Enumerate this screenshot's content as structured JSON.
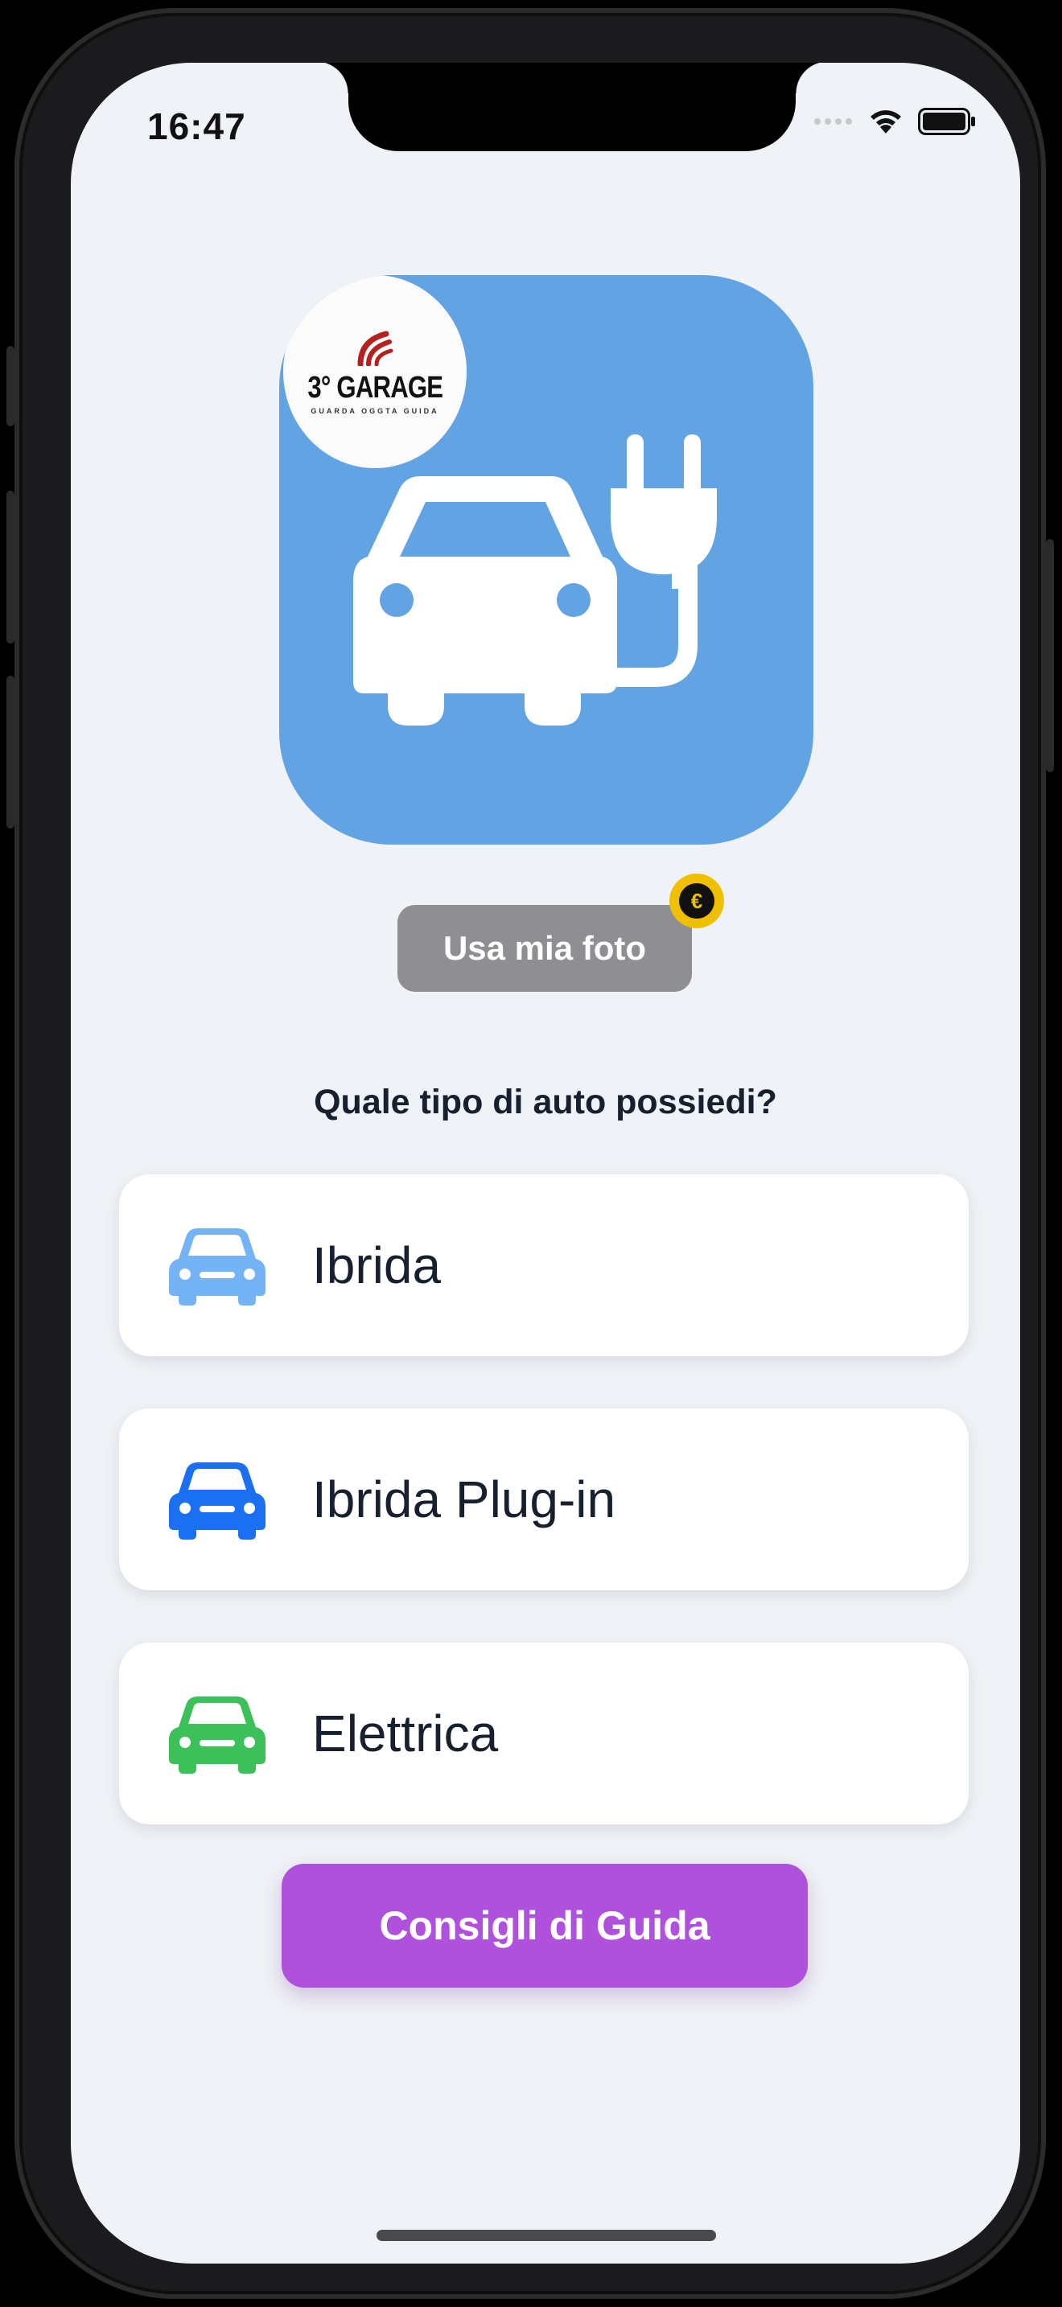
{
  "status_bar": {
    "time": "16:47"
  },
  "logo": {
    "title": "3° GARAGE",
    "subtitle": "GUARDA OGGTA GUIDA",
    "brand_color": "#b3221e"
  },
  "app_icon": {
    "background": "#62a3e3",
    "icon": "car-with-plug-icon"
  },
  "photo_button": {
    "label": "Usa mia foto",
    "badge_icon": "euro-coin-icon",
    "badge_symbol": "€"
  },
  "question": "Quale tipo di auto possiedi?",
  "options": [
    {
      "label": "Ibrida",
      "icon": "car-icon",
      "color": "#74b4f6"
    },
    {
      "label": "Ibrida Plug-in",
      "icon": "car-icon",
      "color": "#1a70f0"
    },
    {
      "label": "Elettrica",
      "icon": "car-icon",
      "color": "#3bc05a"
    }
  ],
  "guide_button": {
    "label": "Consigli di Guida",
    "color": "#af51dd"
  }
}
